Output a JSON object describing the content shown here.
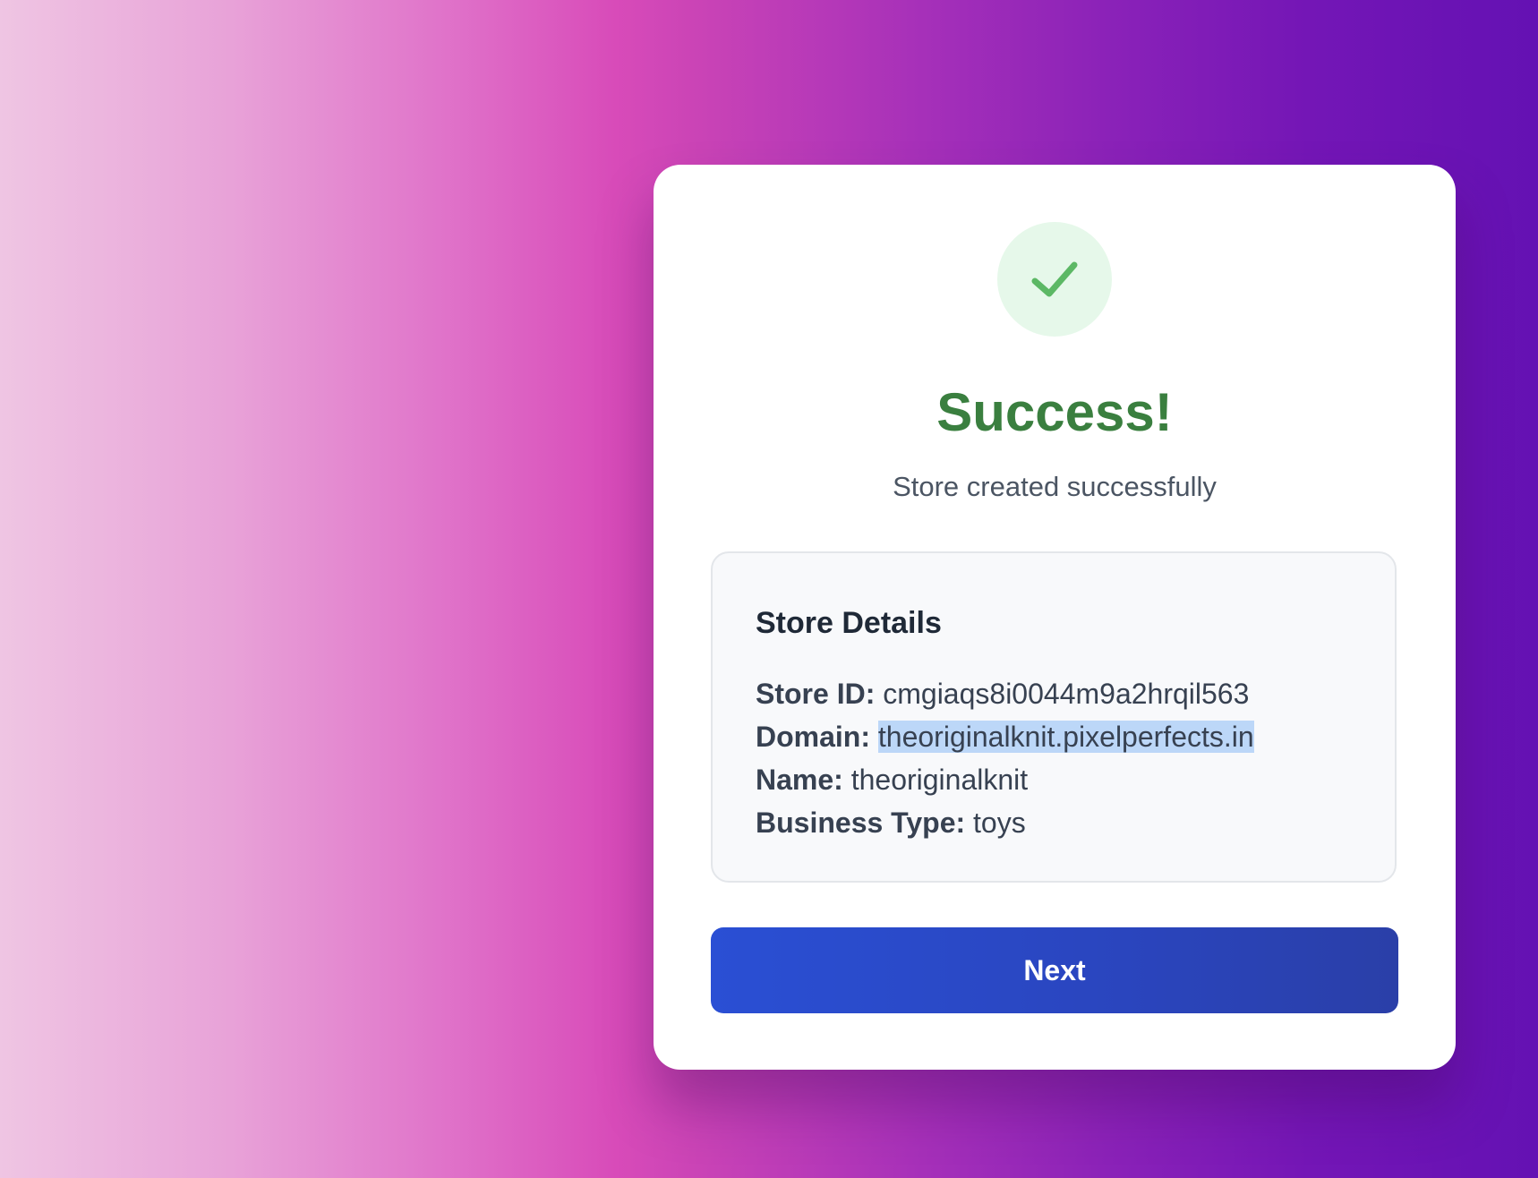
{
  "colors": {
    "accent_success": "#3a7f3f",
    "check_bg": "#e6f8ea",
    "check_stroke": "#5cb865",
    "button_blue": "#2a4fd4",
    "selection_highlight": "#bcd7f8"
  },
  "icons": {
    "status": "checkmark-icon"
  },
  "header": {
    "title": "Success!",
    "subtitle": "Store created successfully"
  },
  "store_details": {
    "title": "Store Details",
    "store_id_label": "Store ID:",
    "store_id_value": "cmgiaqs8i0044m9a2hrqil563",
    "domain_label": "Domain:",
    "domain_value": "theoriginalknit.pixelperfects.in",
    "name_label": "Name:",
    "name_value": "theoriginalknit",
    "business_type_label": "Business Type:",
    "business_type_value": "toys"
  },
  "actions": {
    "next_label": "Next"
  }
}
